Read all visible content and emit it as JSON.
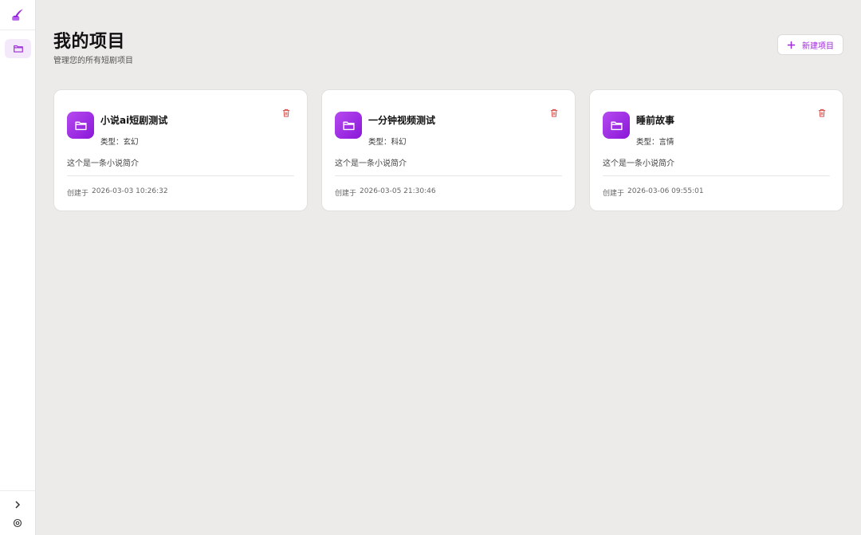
{
  "sidebar": {
    "logo_icon": "quill-ink-icon",
    "nav_items": [
      {
        "icon": "folder-icon",
        "active": true
      }
    ],
    "expand_icon": "chevron-right-icon",
    "settings_icon": "settings-icon"
  },
  "header": {
    "title": "我的项目",
    "subtitle": "管理您的所有短剧项目",
    "new_button_label": "新建项目",
    "new_button_icon": "plus-icon"
  },
  "colors": {
    "accent": "#9b2bd6",
    "accent_light": "#f4e9fb",
    "delete": "#d9534f",
    "background": "#ecebe9"
  },
  "projects": [
    {
      "title": "小说ai短剧测试",
      "type_label": "类型：",
      "type_value": "玄幻",
      "description": "这个是一条小说简介",
      "created_label": "创建于",
      "created_at": "2026-03-03 10:26:32"
    },
    {
      "title": "一分钟视频测试",
      "type_label": "类型：",
      "type_value": "科幻",
      "description": "这个是一条小说简介",
      "created_label": "创建于",
      "created_at": "2026-03-05 21:30:46"
    },
    {
      "title": "睡前故事",
      "type_label": "类型：",
      "type_value": "言情",
      "description": "这个是一条小说简介",
      "created_label": "创建于",
      "created_at": "2026-03-06 09:55:01"
    }
  ]
}
